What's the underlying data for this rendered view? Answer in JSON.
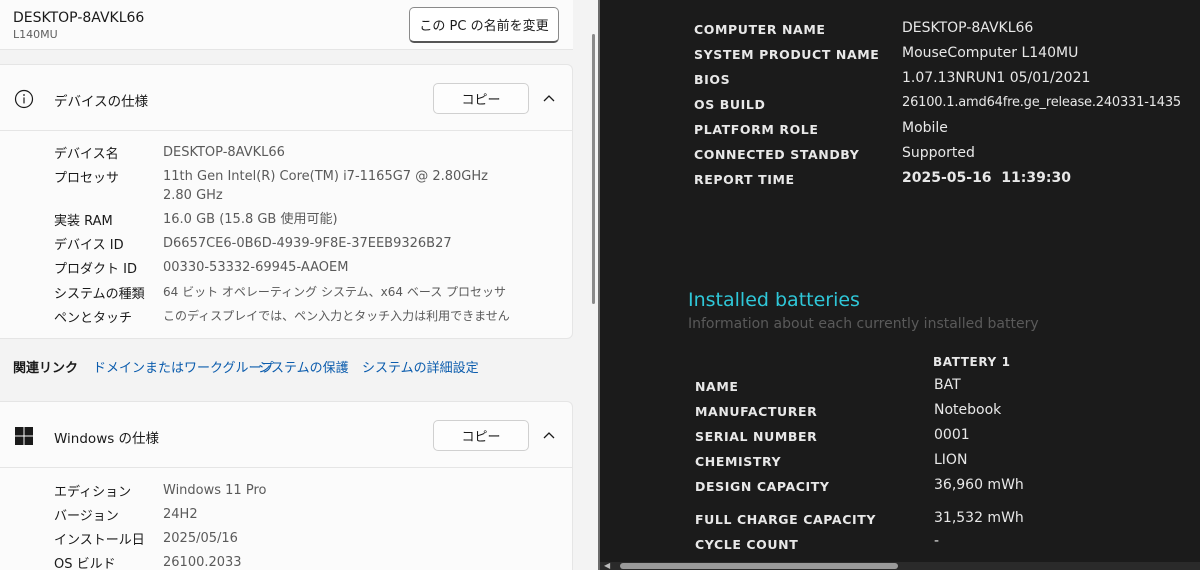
{
  "pc": {
    "name": "DESKTOP-8AVKL66",
    "model": "L140MU",
    "rename_label": "この PC の名前を変更"
  },
  "device_spec": {
    "title": "デバイスの仕様",
    "copy_label": "コピー",
    "rows": [
      {
        "label": "デバイス名",
        "value": "DESKTOP-8AVKL66"
      },
      {
        "label": "プロセッサ",
        "value": "11th Gen Intel(R) Core(TM) i7-1165G7 @ 2.80GHz   2.80 GHz"
      },
      {
        "label": "実装 RAM",
        "value": "16.0 GB (15.8 GB 使用可能)"
      },
      {
        "label": "デバイス ID",
        "value": "D6657CE6-0B6D-4939-9F8E-37EEB9326B27"
      },
      {
        "label": "プロダクト ID",
        "value": "00330-53332-69945-AAOEM"
      },
      {
        "label": "システムの種類",
        "value": "64 ビット オペレーティング システム、x64 ベース プロセッサ"
      },
      {
        "label": "ペンとタッチ",
        "value": "このディスプレイでは、ペン入力とタッチ入力は利用できません"
      }
    ]
  },
  "related": {
    "title": "関連リンク",
    "links": [
      "ドメインまたはワークグループ",
      "システムの保護",
      "システムの詳細設定"
    ]
  },
  "windows_spec": {
    "title": "Windows の仕様",
    "copy_label": "コピー",
    "rows": [
      {
        "label": "エディション",
        "value": "Windows 11 Pro"
      },
      {
        "label": "バージョン",
        "value": "24H2"
      },
      {
        "label": "インストール日",
        "value": "2025/05/16"
      },
      {
        "label": "OS ビルド",
        "value": "26100.2033"
      }
    ]
  },
  "report": {
    "system": [
      {
        "key": "COMPUTER NAME",
        "value": "DESKTOP-8AVKL66"
      },
      {
        "key": "SYSTEM PRODUCT NAME",
        "value": "MouseComputer L140MU"
      },
      {
        "key": "BIOS",
        "value": "1.07.13NRUN1 05/01/2021"
      },
      {
        "key": "OS BUILD",
        "value": "26100.1.amd64fre.ge_release.240331-1435"
      },
      {
        "key": "PLATFORM ROLE",
        "value": "Mobile"
      },
      {
        "key": "CONNECTED STANDBY",
        "value": "Supported"
      },
      {
        "key": "REPORT TIME",
        "value": "2025-05-16  11:39:30"
      }
    ],
    "batteries_title": "Installed batteries",
    "batteries_subtitle": "Information about each currently installed battery",
    "battery_column": "BATTERY 1",
    "battery": [
      {
        "key": "NAME",
        "value": "BAT"
      },
      {
        "key": "MANUFACTURER",
        "value": "Notebook"
      },
      {
        "key": "SERIAL NUMBER",
        "value": "0001"
      },
      {
        "key": "CHEMISTRY",
        "value": "LION"
      },
      {
        "key": "DESIGN CAPACITY",
        "value": "36,960 mWh"
      },
      {
        "key": "FULL CHARGE CAPACITY",
        "value": "31,532 mWh"
      },
      {
        "key": "CYCLE COUNT",
        "value": "-"
      }
    ]
  },
  "icons": {
    "info": "info-icon",
    "windows": "windows-logo-icon",
    "chevron": "chevron-up-icon"
  }
}
